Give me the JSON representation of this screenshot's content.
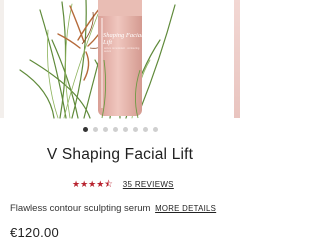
{
  "product": {
    "image_text_name": "Shaping Facial Lift",
    "image_text_small": "sérum remodelant · contouring serum",
    "title": "V Shaping Facial Lift",
    "rating": 4.5,
    "stars": "★★★★⯪",
    "reviews_label": "35 REVIEWS",
    "description": "Flawless contour sculpting serum",
    "more_details_label": "MORE DETAILS",
    "price": "€120.00"
  },
  "carousel": {
    "slide_count": 8,
    "active_index": 0
  },
  "colors": {
    "accent_red": "#b8232f",
    "bottle_pink": "#e8b9b1",
    "text_dark": "#222222"
  }
}
